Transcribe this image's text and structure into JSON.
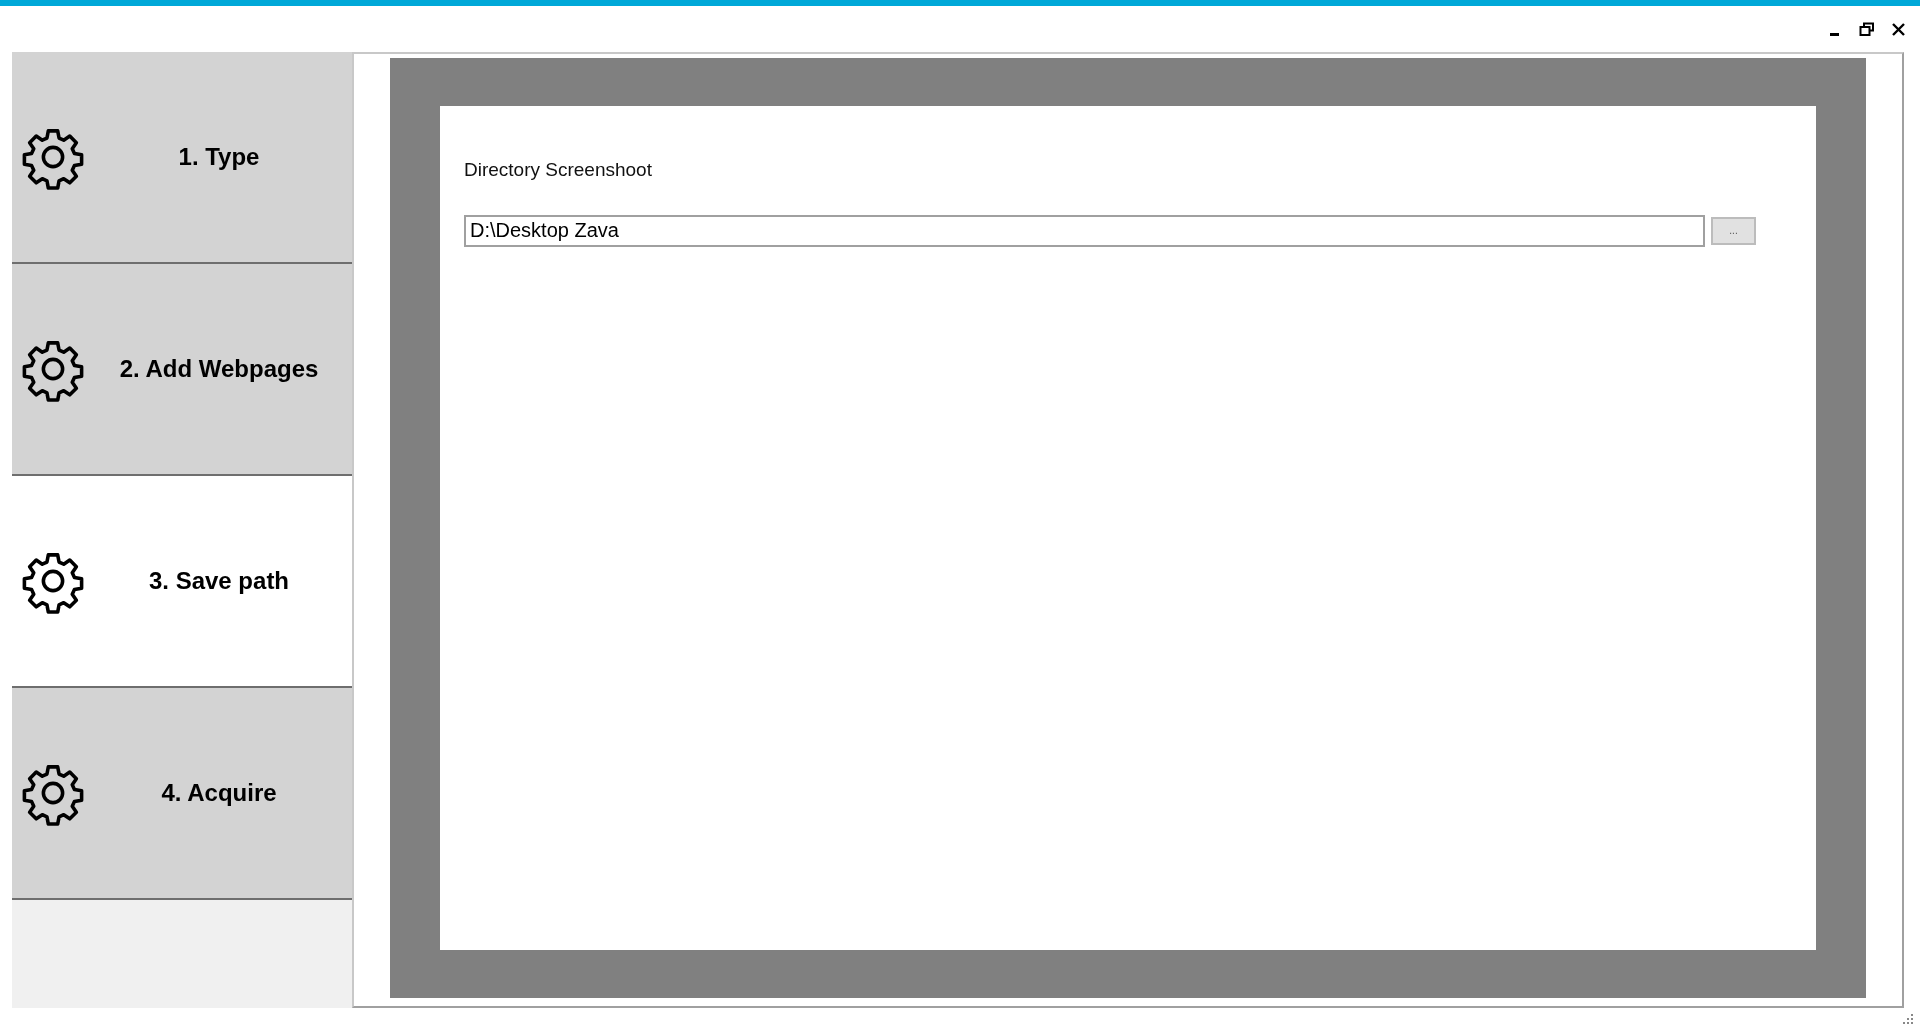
{
  "tabs": [
    {
      "label": "1. Type",
      "selected": false
    },
    {
      "label": "2. Add Webpages",
      "selected": false
    },
    {
      "label": "3. Save path",
      "selected": true
    },
    {
      "label": "4. Acquire",
      "selected": false
    }
  ],
  "form": {
    "label": "Directory Screenshoot",
    "path_value": "D:\\Desktop Zava",
    "browse_button": "..."
  }
}
